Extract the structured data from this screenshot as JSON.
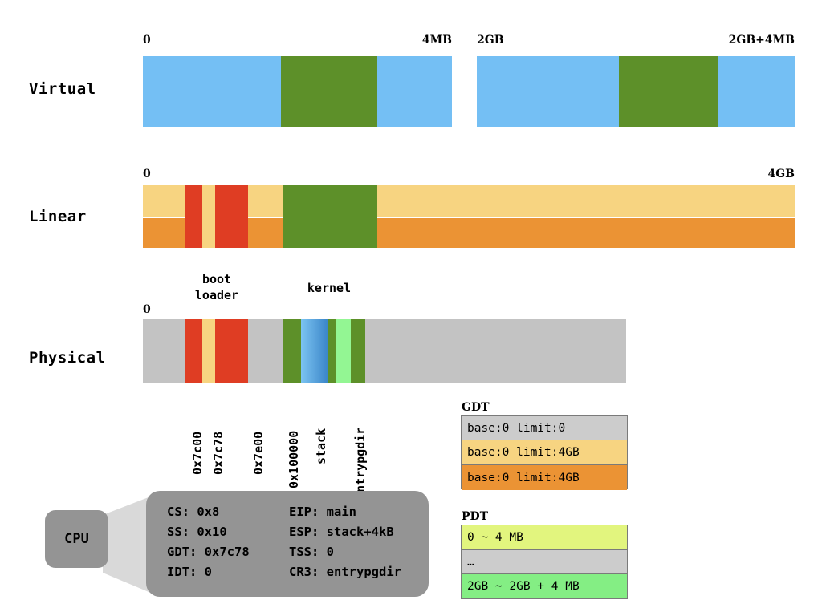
{
  "diagram": {
    "rows": [
      {
        "label": "Virtual"
      },
      {
        "label": "Linear"
      },
      {
        "label": "Physical"
      }
    ],
    "virtual": {
      "blocks": [
        {
          "start_label": "0",
          "end_label": "4MB"
        },
        {
          "start_label": "2GB",
          "end_label": "2GB+4MB"
        }
      ]
    },
    "linear": {
      "start_label": "0",
      "end_label": "4GB"
    },
    "physical": {
      "start_label": "0",
      "callouts": [
        {
          "text": "boot\nloader"
        },
        {
          "text": "kernel"
        }
      ],
      "markers": [
        "0x7c00",
        "0x7c78",
        "0x7e00",
        "0x100000",
        "stack",
        "entrypgdir"
      ]
    }
  },
  "gdt": {
    "title": "GDT",
    "rows": [
      {
        "text": "base:0 limit:0",
        "color": "#cccccc"
      },
      {
        "text": "base:0 limit:4GB",
        "color": "#f7d481"
      },
      {
        "text": "base:0 limit:4GB",
        "color": "#eb9334"
      }
    ]
  },
  "pdt": {
    "title": "PDT",
    "rows": [
      {
        "text": "0 ~ 4 MB",
        "color": "#e2f57e"
      },
      {
        "text": "…",
        "color": "#cccccc"
      },
      {
        "text": "2GB ~ 2GB + 4 MB",
        "color": "#84ee84"
      }
    ]
  },
  "cpu": {
    "label": "CPU",
    "registers": [
      {
        "left": "CS: 0x8",
        "right": "EIP: main"
      },
      {
        "left": "SS: 0x10",
        "right": "ESP: stack+4kB"
      },
      {
        "left": "GDT: 0x7c78",
        "right": "TSS: 0"
      },
      {
        "left": "IDT: 0",
        "right": "CR3: entrypgdir"
      }
    ]
  },
  "colors": {
    "blue": "#74bff4",
    "green": "#5d9029",
    "tan": "#f7d481",
    "orange": "#eb9334",
    "red": "#df3d23",
    "gray": "#c3c3c3",
    "light_green": "#93f693",
    "cpu_gray": "#949494",
    "connector_gray": "#d9d9d9"
  }
}
